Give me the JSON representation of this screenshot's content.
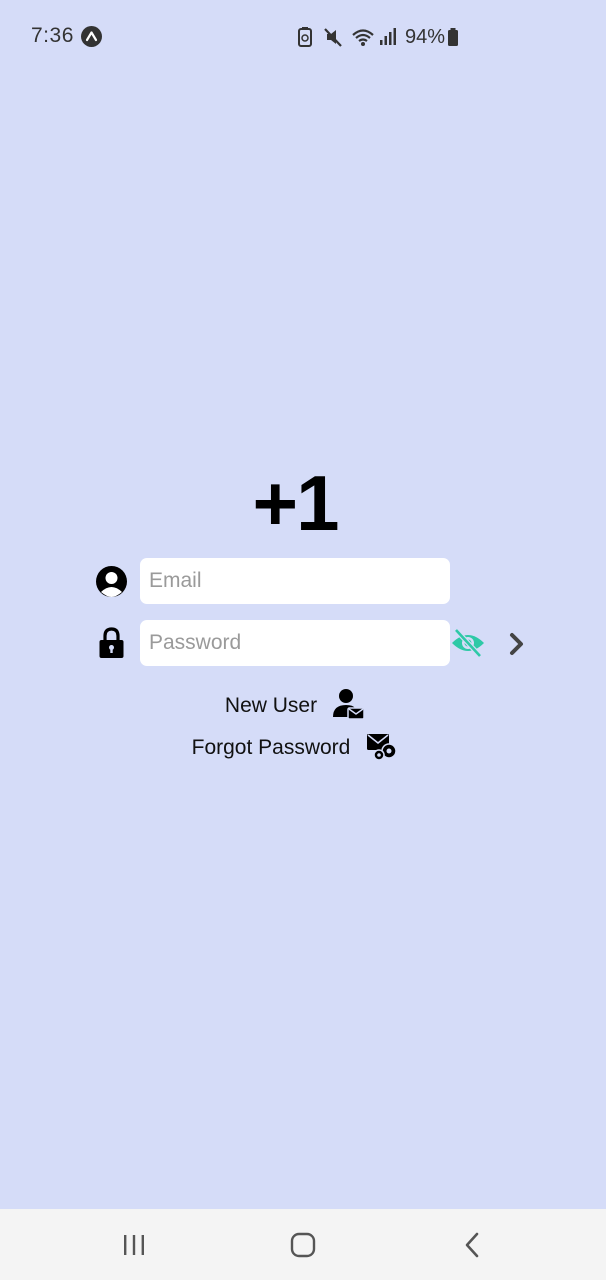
{
  "status_bar": {
    "time": "7:36",
    "battery_percent": "94%",
    "icons": [
      "app-notification-icon",
      "battery-saver-icon",
      "mute-icon",
      "wifi-icon",
      "signal-icon",
      "battery-icon"
    ]
  },
  "login": {
    "logo": "+1",
    "email_placeholder": "Email",
    "email_value": "",
    "password_placeholder": "Password",
    "password_value": "",
    "new_user_label": "New User",
    "forgot_password_label": "Forgot Password"
  },
  "nav": {
    "buttons": [
      "recent-apps",
      "home",
      "back"
    ]
  },
  "colors": {
    "background": "#d5dcf8",
    "field_bg": "#ffffff",
    "eye_icon": "#2ec9a7",
    "nav_bg": "#f4f4f4"
  }
}
